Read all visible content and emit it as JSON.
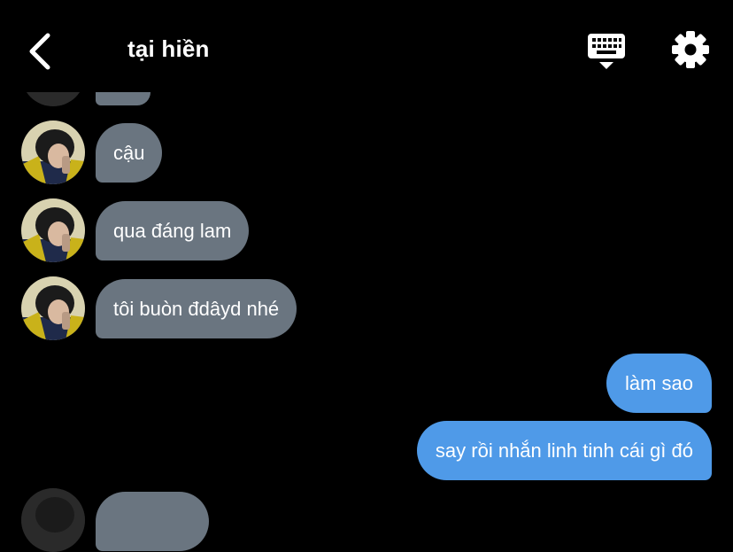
{
  "header": {
    "title": "tại hiền",
    "back_icon": "chevron-left-icon",
    "keyboard_icon": "keyboard-hide-icon",
    "settings_icon": "gear-icon"
  },
  "messages": [
    {
      "side": "in",
      "text": "cậu"
    },
    {
      "side": "in",
      "text": "qua đáng lam"
    },
    {
      "side": "in",
      "text": "tôi buòn đdâyd nhé"
    },
    {
      "side": "out",
      "text": "làm sao"
    },
    {
      "side": "out",
      "text": "say rồi nhắn linh tinh cái gì đó"
    }
  ],
  "colors": {
    "background": "#000000",
    "incoming_bubble": "#6a7580",
    "outgoing_bubble": "#4f9ae8",
    "text": "#ffffff"
  }
}
